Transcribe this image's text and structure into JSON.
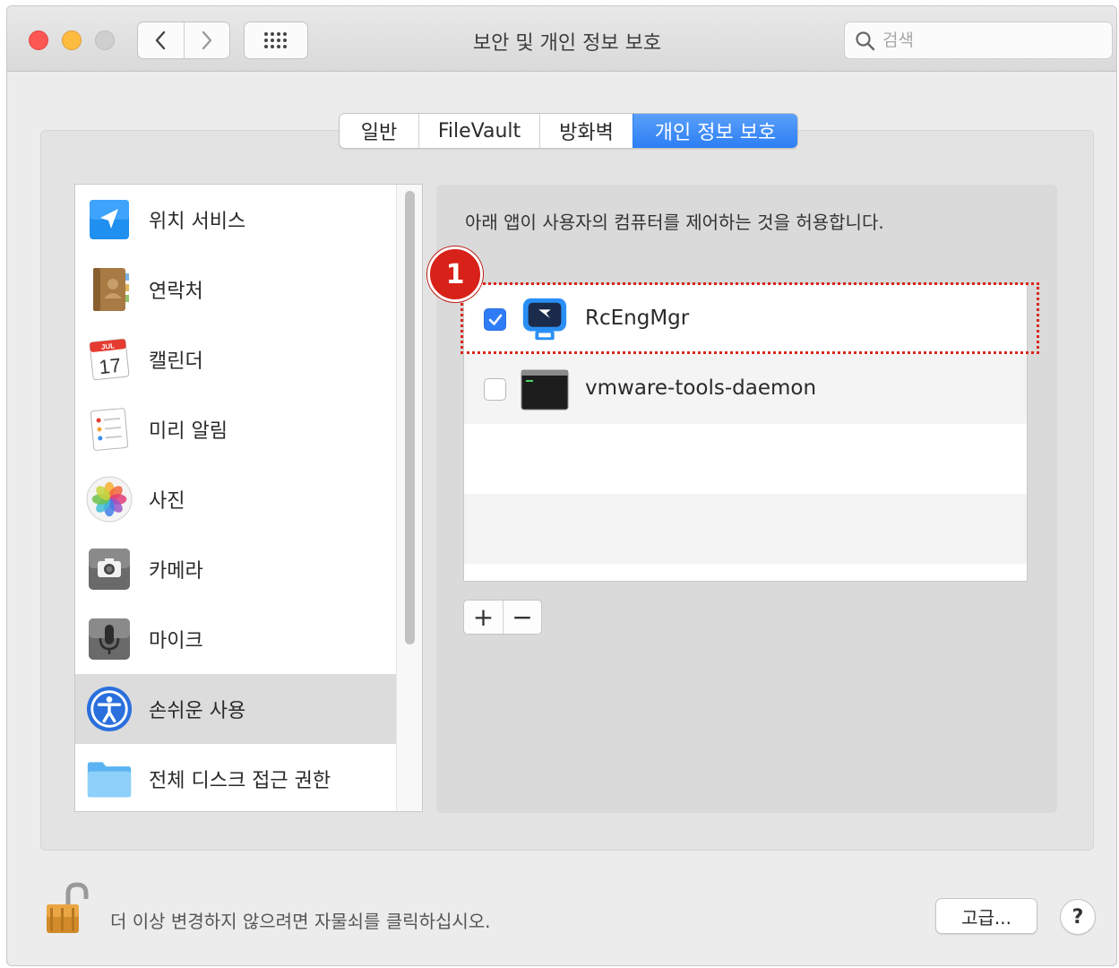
{
  "window": {
    "title": "보안 및 개인 정보 보호"
  },
  "search": {
    "placeholder": "검색",
    "icon": "search-icon"
  },
  "tabs": [
    {
      "label": "일반",
      "active": false
    },
    {
      "label": "FileVault",
      "active": false
    },
    {
      "label": "방화벽",
      "active": false
    },
    {
      "label": "개인 정보 보호",
      "active": true
    }
  ],
  "categories": [
    {
      "label": "위치 서비스",
      "icon": "location-arrow-icon"
    },
    {
      "label": "연락처",
      "icon": "contacts-book-icon"
    },
    {
      "label": "캘린더",
      "icon": "calendar-icon",
      "icon_month": "JUL",
      "icon_day": "17"
    },
    {
      "label": "미리 알림",
      "icon": "reminders-icon"
    },
    {
      "label": "사진",
      "icon": "photos-icon"
    },
    {
      "label": "카메라",
      "icon": "camera-icon"
    },
    {
      "label": "마이크",
      "icon": "microphone-icon"
    },
    {
      "label": "손쉬운 사용",
      "icon": "accessibility-icon",
      "selected": true
    },
    {
      "label": "전체 디스크 접근 권한",
      "icon": "folder-icon"
    }
  ],
  "content": {
    "description": "아래 앱이 사용자의 컴퓨터를 제어하는 것을 허용합니다.",
    "apps": [
      {
        "name": "RcEngMgr",
        "checked": true,
        "icon": "rcengmgr-app-icon"
      },
      {
        "name": "vmware-tools-daemon",
        "checked": false,
        "icon": "terminal-app-icon"
      }
    ],
    "add_label": "+",
    "remove_label": "−"
  },
  "annotation": {
    "badge_number": "1",
    "color": "#d82118"
  },
  "footer": {
    "lock_text": "더 이상 변경하지 않으려면 자물쇠를 클릭하십시오.",
    "advanced_label": "고급...",
    "help_label": "?"
  },
  "colors": {
    "accent": "#2f7cf6",
    "traffic_red": "#fc5753",
    "traffic_yellow": "#fdbc40"
  }
}
